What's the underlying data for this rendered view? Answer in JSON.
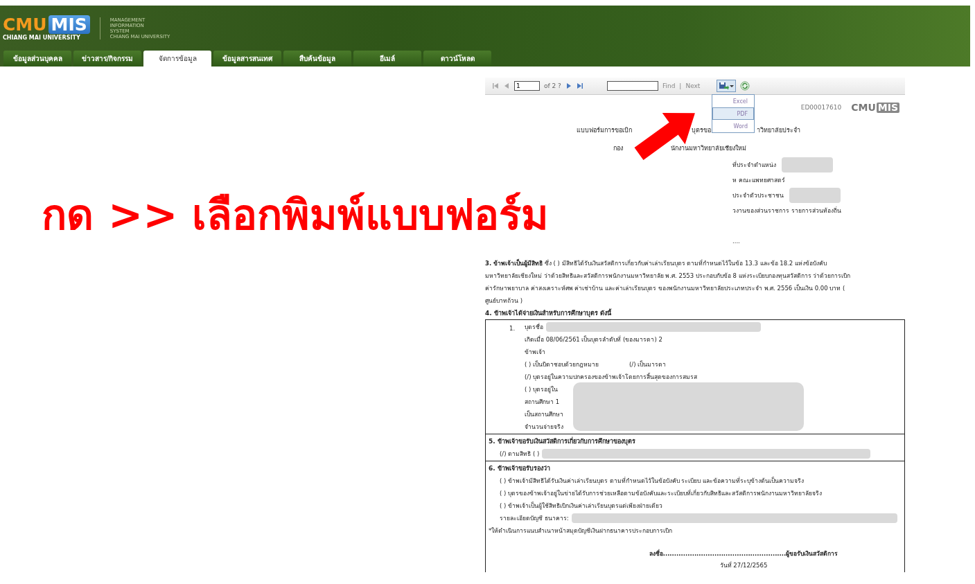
{
  "header": {
    "logo": {
      "cmu": "CMU",
      "mis": "MIS",
      "university": "CHIANG MAI UNIVERSITY"
    },
    "system_name": [
      "MANAGEMENT",
      "INFORMATION",
      "SYSTEM",
      "CHIANG MAI UNIVERSITY"
    ]
  },
  "tabs": [
    {
      "label": "ข้อมูลส่วนบุคคล",
      "selected": false
    },
    {
      "label": "ข่าวสาร/กิจกรรม",
      "selected": false
    },
    {
      "label": "จัดการข้อมูล",
      "selected": true
    },
    {
      "label": "ข้อมูลสารสนเทศ",
      "selected": false
    },
    {
      "label": "สืบค้นข้อมูล",
      "selected": false
    },
    {
      "label": "อีเมล์",
      "selected": false
    },
    {
      "label": "ดาวน์โหลด",
      "selected": false
    }
  ],
  "toolbar": {
    "page": "1",
    "page_count": "of 2 ?",
    "find_link": "Find",
    "separator": "|",
    "next_link": "Next"
  },
  "export_menu": [
    {
      "label": "Excel",
      "selected": false
    },
    {
      "label": "PDF",
      "selected": true
    },
    {
      "label": "Word",
      "selected": false
    }
  ],
  "report": {
    "document_id": "ED00017610",
    "logo": {
      "cmu": "CMU",
      "mis": "MIS"
    },
    "title_lines": [
      [
        "แบบฟอร์มการขอเบิก",
        "บุตรขอ",
        "าวิทยาลัยประจำ"
      ],
      [
        "กอง",
        "นักงานมหาวิทยาลัยเชียงใหม่"
      ]
    ],
    "fields": [
      {
        "text": "ที่ประจำตำแหน่ง",
        "redacted": true
      },
      {
        "text": "ห    คณะแพทยศาสตร์",
        "redacted": false
      },
      {
        "text": "ประจำตัวประชาชน",
        "redacted": true
      },
      {
        "text": "วงานของส่วนราชการ รายการส่วนท้องถิ่น",
        "redacted": false
      }
    ],
    "ellipsis": "....",
    "section_3": [
      "**3. ข้าพเจ้าเป็นผู้มีสิทธิ** ซึ่ง (   ) มีสิทธิได้รับเงินสวัสดิการเกี่ยวกับค่าเล่าเรียนบุตร ตามที่กำหนดไว้ในข้อ 13.3 และข้อ 18.2  แห่งข้อบังคับ",
      "มหาวิทยาลัยเชียงใหม่ ว่าด้วยสิทธิและสวัสดิการพนักงานมหาวิทยาลัย พ.ศ. 2553 ประกอบกับข้อ 8 แห่งระเบียบกองทุนสวัสดิการ ว่าด้วยการเบิก",
      "ค่ารักษาพยาบาล ค่าสงเคราะห์ศพ ค่าเช่าบ้าน และค่าเล่าเรียนบุตร ของพนักงานมหาวิทยาลัยประเภทประจำ พ.ศ. 2556 เป็นเงิน    0.00 บาท (",
      "ศูนย์บาทถ้วน )"
    ],
    "section_4_heading": "4. ข้าพเจ้าได้จ่ายเงินสำหรับการศึกษาบุตร ดังนี้",
    "child": {
      "number": "1.",
      "redacted": true,
      "lines": [
        {
          "text": "บุตรชื่อ",
          "redacted": true
        },
        {
          "text": "เกิดเมื่อ  08/06/2561   เป็นบุตรลำดับที่ (ของมารดา)       2",
          "redacted": false
        },
        {
          "text": "ข้าพเจ้า",
          "redacted": false
        },
        {
          "text": "( ) เป็นบิดาชอบด้วยกฎหมาย",
          "extra": "(/) เป็นมารดา",
          "redacted": false
        },
        {
          "text": "(/) บุตรอยู่ในความปกครองของข้าพเจ้าโดยการสิ้นสุดของการสมรส",
          "redacted": false
        },
        {
          "text": "( ) บุตรอยู่ใน",
          "redacted": false
        },
        {
          "text": "สถานศึกษา    1",
          "redacted": false
        },
        {
          "text": "เป็นสถานศึกษา",
          "redacted": false
        },
        {
          "text": "จำนวนจ่ายจริง",
          "redacted": false
        }
      ]
    },
    "section_5": {
      "heading": "5. ข้าพเจ้าขอรับเงินสวัสดิการเกี่ยวกับการศึกษาของบุตร",
      "lines": [
        {
          "text": "(/) ตามสิทธิ ( )",
          "redacted": true
        }
      ]
    },
    "section_6": {
      "heading": "6. ข้าพเจ้าขอรับรองว่า",
      "lines": [
        {
          "text": "(   ) ข้าพเจ้ามีสิทธิได้รับเงินค่าเล่าเรียนบุตร ตามที่กำหนดไว้ในข้อบังคับ ระเบียบ และข้อความที่ระบุข้างต้นเป็นความจริง",
          "redacted": false
        },
        {
          "text": "(   ) บุตรของข้าพเจ้าอยู่ในข่ายได้รับการช่วยเหลือตามข้อบังคับและระเบียบที่เกี่ยวกับสิทธิและสวัสดิการพนักงานมหาวิทยาลัยจริง",
          "redacted": false
        },
        {
          "text": "(   ) ข้าพเจ้าเป็นผู้ใช้สิทธิเบิกเงินค่าเล่าเรียนบุตรแต่เพียงฝ่ายเดียว",
          "redacted": false
        },
        {
          "text": "รายละเอียดบัญชี ธนาคาร:",
          "redacted": true
        }
      ],
      "note": "*ให้ดำเนินการแนบสำเนาหน้าสมุดบัญชีเงินฝากธนาคารประกอบการเบิก",
      "signature": "ลงชื่อ.......................................................ผู้ขอรับเงินสวัสดิการ",
      "date": "วันที่ 27/12/2565"
    }
  },
  "annotation": {
    "text": "กด >> เลือกพิมพ์แบบฟอร์ม"
  }
}
